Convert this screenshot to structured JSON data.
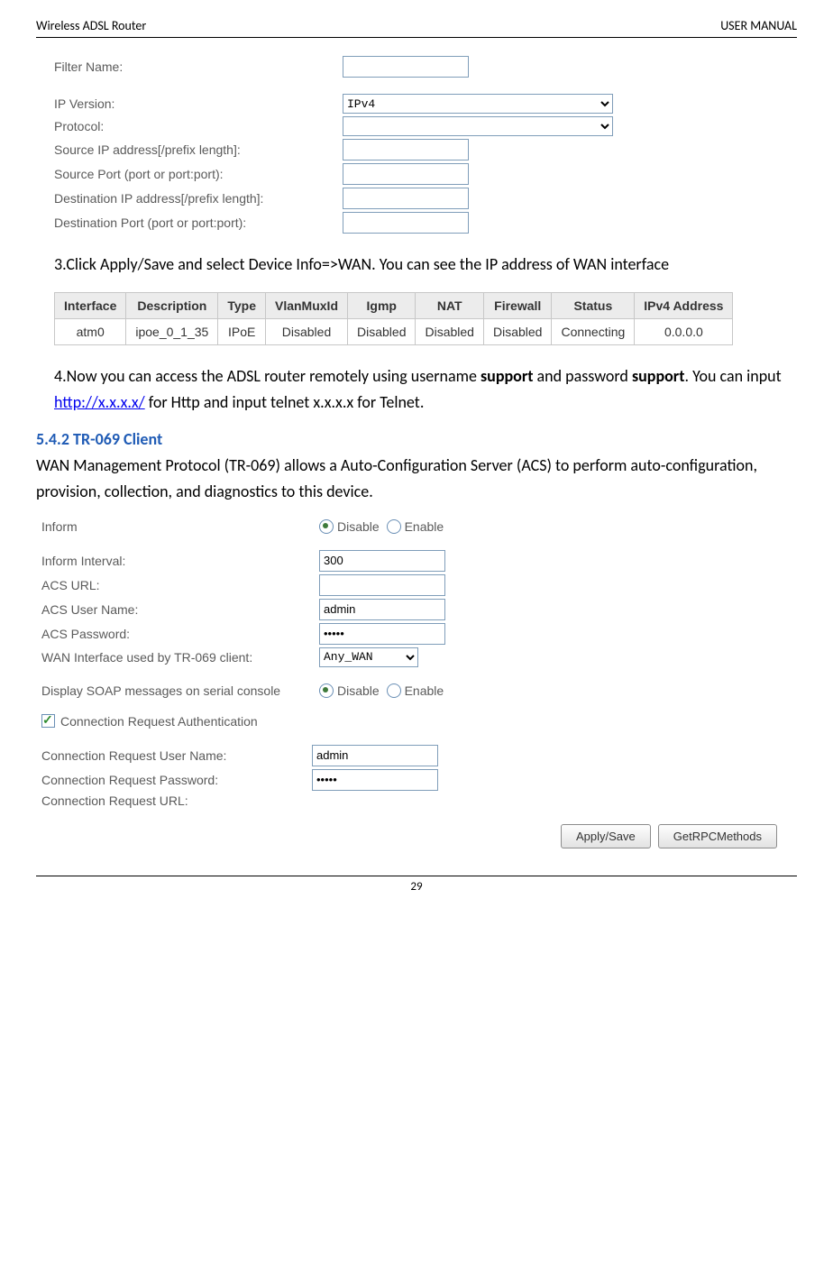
{
  "header": {
    "left": "Wireless ADSL Router",
    "right": "USER MANUAL"
  },
  "filter_form": {
    "filter_name_label": "Filter Name:",
    "filter_name_value": "",
    "ip_version_label": "IP Version:",
    "ip_version_value": "IPv4",
    "protocol_label": "Protocol:",
    "protocol_value": "",
    "src_ip_label": "Source IP address[/prefix length]:",
    "src_ip_value": "",
    "src_port_label": "Source Port (port or port:port):",
    "src_port_value": "",
    "dst_ip_label": "Destination IP address[/prefix length]:",
    "dst_ip_value": "",
    "dst_port_label": "Destination Port (port or port:port):",
    "dst_port_value": ""
  },
  "step3": "3.Click Apply/Save and select Device Info=>WAN. You can see the IP address of WAN interface",
  "wan_table": {
    "headers": [
      "Interface",
      "Description",
      "Type",
      "VlanMuxId",
      "Igmp",
      "NAT",
      "Firewall",
      "Status",
      "IPv4 Address"
    ],
    "row": [
      "atm0",
      "ipoe_0_1_35",
      "IPoE",
      "Disabled",
      "Disabled",
      "Disabled",
      "Disabled",
      "Connecting",
      "0.0.0.0"
    ]
  },
  "step4_pre": "4.Now you can access the ADSL router remotely using username ",
  "step4_user": "support",
  "step4_mid1": " and password ",
  "step4_pass": "support",
  "step4_mid2": ". You can input ",
  "step4_link": "http://x.x.x.x/",
  "step4_post": " for Http and input telnet x.x.x.x for Telnet.",
  "section_heading": "5.4.2 TR-069 Client",
  "section_body": "WAN Management Protocol (TR-069) allows a Auto-Configuration Server (ACS) to perform auto-configuration, provision, collection, and diagnostics to this device.",
  "tr069": {
    "inform_label": "Inform",
    "disable_label": "Disable",
    "enable_label": "Enable",
    "inform_interval_label": "Inform Interval:",
    "inform_interval_value": "300",
    "acs_url_label": "ACS URL:",
    "acs_url_value": "",
    "acs_user_label": "ACS User Name:",
    "acs_user_value": "admin",
    "acs_pass_label": "ACS Password:",
    "acs_pass_value": "•••••",
    "wan_if_label": "WAN Interface used by TR-069 client:",
    "wan_if_value": "Any_WAN",
    "soap_label": "Display SOAP messages on serial console",
    "conn_auth_label": "Connection Request Authentication",
    "cr_user_label": "Connection Request User Name:",
    "cr_user_value": "admin",
    "cr_pass_label": "Connection Request Password:",
    "cr_pass_value": "•••••",
    "cr_url_label": "Connection Request URL:"
  },
  "buttons": {
    "apply": "Apply/Save",
    "rpc": "GetRPCMethods"
  },
  "page_number": "29"
}
